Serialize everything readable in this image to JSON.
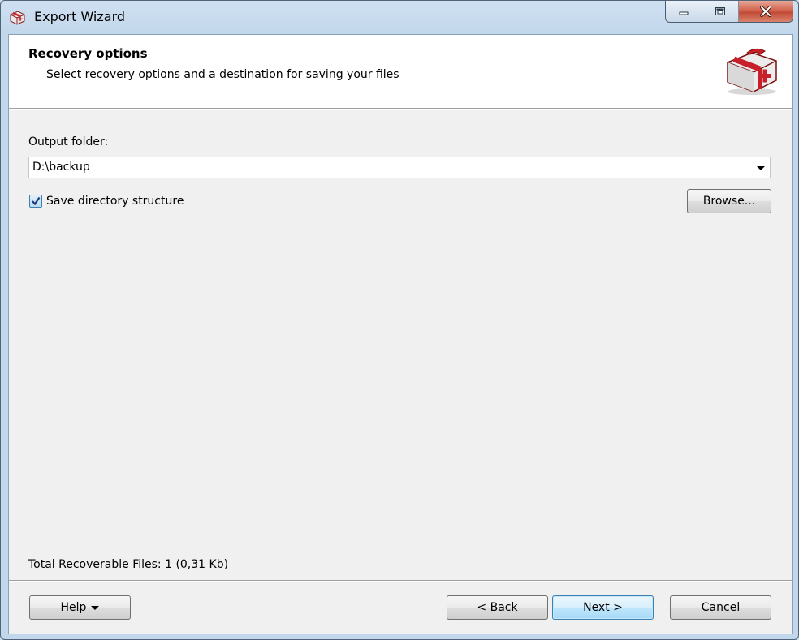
{
  "window": {
    "title": "Export Wizard",
    "icons": {
      "app": "first-aid-kit-icon",
      "minimize": "minimize-icon",
      "maximize": "maximize-icon",
      "close": "close-icon"
    }
  },
  "header": {
    "title": "Recovery options",
    "subtitle": "Select recovery options and a destination for saving your files",
    "icon": "first-aid-kit-icon"
  },
  "output": {
    "label": "Output folder:",
    "value": "D:\\backup"
  },
  "options": {
    "save_structure_label": "Save directory structure",
    "save_structure_checked": true,
    "browse_label": "Browse..."
  },
  "status": {
    "total_files": "Total Recoverable Files: 1 (0,31 Kb)"
  },
  "footer": {
    "help_label": "Help",
    "back_label": "< Back",
    "next_label": "Next >",
    "cancel_label": "Cancel"
  },
  "colors": {
    "accent": "#3c7fb1",
    "kit_red": "#c8202a",
    "window_frame": "#c3d7ec"
  }
}
